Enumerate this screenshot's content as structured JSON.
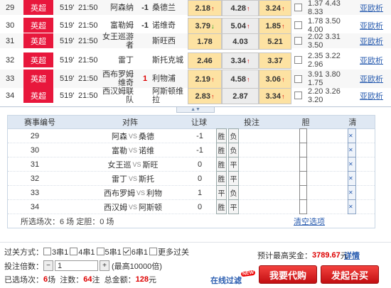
{
  "matches": [
    {
      "no": "29",
      "league": "英超",
      "week": "519'",
      "time": "21:50",
      "home": "阿森纳",
      "handicap": "-1",
      "away": "桑德兰",
      "odds": [
        {
          "v": "2.18",
          "dir": "up"
        },
        {
          "v": "4.28",
          "dir": "up"
        },
        {
          "v": "3.24",
          "dir": "up"
        }
      ],
      "stats": "1.37 4.43 8.33",
      "link": "亚欧析"
    },
    {
      "no": "30",
      "league": "英超",
      "week": "519'",
      "time": "21:50",
      "home": "富勒姆",
      "handicap": "-1",
      "away": "诺维奇",
      "odds": [
        {
          "v": "3.79",
          "dir": "down"
        },
        {
          "v": "5.04",
          "dir": "up"
        },
        {
          "v": "1.85",
          "dir": "up"
        }
      ],
      "stats": "1.78 3.50 4.00",
      "link": "亚欧析"
    },
    {
      "no": "31",
      "league": "英超",
      "week": "519'",
      "time": "21:50",
      "home": "女王巡游者",
      "handicap": "",
      "away": "斯旺西",
      "odds": [
        {
          "v": "1.78",
          "dir": "none"
        },
        {
          "v": "4.03",
          "dir": "none"
        },
        {
          "v": "5.21",
          "dir": "none"
        }
      ],
      "stats": "2.02 3.31 3.50",
      "link": "亚欧析"
    },
    {
      "no": "32",
      "league": "英超",
      "week": "519'",
      "time": "21:50",
      "home": "雷丁",
      "handicap": "",
      "away": "斯托克城",
      "odds": [
        {
          "v": "2.46",
          "dir": "none"
        },
        {
          "v": "3.34",
          "dir": "up"
        },
        {
          "v": "3.37",
          "dir": "none"
        }
      ],
      "stats": "2.35 3.22 2.96",
      "link": "亚欧析"
    },
    {
      "no": "33",
      "league": "英超",
      "week": "519'",
      "time": "21:50",
      "home": "西布罗姆维奇",
      "handicap": "1",
      "away": "利物浦",
      "odds": [
        {
          "v": "2.19",
          "dir": "up"
        },
        {
          "v": "4.58",
          "dir": "up"
        },
        {
          "v": "3.06",
          "dir": "up"
        }
      ],
      "stats": "3.91 3.80 1.75",
      "link": "亚欧析"
    },
    {
      "no": "34",
      "league": "英超",
      "week": "519'",
      "time": "21:50",
      "home": "西汉姆联队",
      "handicap": "",
      "away": "阿斯顿维拉",
      "odds": [
        {
          "v": "2.83",
          "dir": "up"
        },
        {
          "v": "2.87",
          "dir": "none"
        },
        {
          "v": "3.34",
          "dir": "up"
        }
      ],
      "stats": "2.20 3.26 3.20",
      "link": "亚欧析"
    }
  ],
  "panel": {
    "headers": {
      "id": "赛事编号",
      "match": "对阵",
      "handicap": "让球",
      "bet": "投注",
      "dan": "胆",
      "clear": "清"
    },
    "rows": [
      {
        "id": "29",
        "home": "阿森",
        "away": "桑德",
        "hc": "-1",
        "picks": [
          "胜",
          "负"
        ]
      },
      {
        "id": "30",
        "home": "富勒",
        "away": "诺维",
        "hc": "-1",
        "picks": [
          "胜",
          "负"
        ]
      },
      {
        "id": "31",
        "home": "女王巡",
        "away": "斯旺",
        "hc": "0",
        "picks": [
          "胜",
          "平"
        ]
      },
      {
        "id": "32",
        "home": "雷丁",
        "away": "斯托",
        "hc": "0",
        "picks": [
          "胜",
          "平"
        ]
      },
      {
        "id": "33",
        "home": "西布罗姆",
        "away": "利物",
        "hc": "1",
        "picks": [
          "平",
          "负"
        ]
      },
      {
        "id": "34",
        "home": "西汉姆",
        "away": "阿斯顿",
        "hc": "0",
        "picks": [
          "胜",
          "平"
        ]
      }
    ],
    "vs": "VS",
    "selected_text": "所选场次：6 场 定胆：0 场",
    "clear_label": "清空选项"
  },
  "bottom": {
    "pass_label": "过关方式：",
    "pass_options": [
      {
        "label": "3串1",
        "checked": false
      },
      {
        "label": "4串1",
        "checked": false
      },
      {
        "label": "5串1",
        "checked": false
      },
      {
        "label": "6串1",
        "checked": true
      },
      {
        "label": "更多过关",
        "checked": false
      }
    ],
    "multiplier_label": "投注倍数：",
    "multiplier_value": "1",
    "multiplier_max": "(最高10000倍)",
    "summary": {
      "prefix": "已选场次：",
      "matches": "6",
      "matches_unit": "场  注数：",
      "bets": "64",
      "bets_unit": "注  总金额：",
      "amount": "128",
      "amount_unit": "元"
    },
    "max_prize_label": "预计最高奖金：",
    "max_prize_value": "3789.67",
    "max_prize_unit": "元",
    "detail_link": "详情",
    "filter_link": "在线过滤",
    "new_badge": "NEW",
    "buttons": {
      "proxy": "我要代购",
      "group": "发起合买"
    }
  },
  "colors": {
    "league_bg": "#e8173c",
    "odds_highlight": "#fde2a2",
    "up": "#dd0000",
    "down": "#009900",
    "button_red": "#d41a1c",
    "link": "#2a5db0"
  }
}
